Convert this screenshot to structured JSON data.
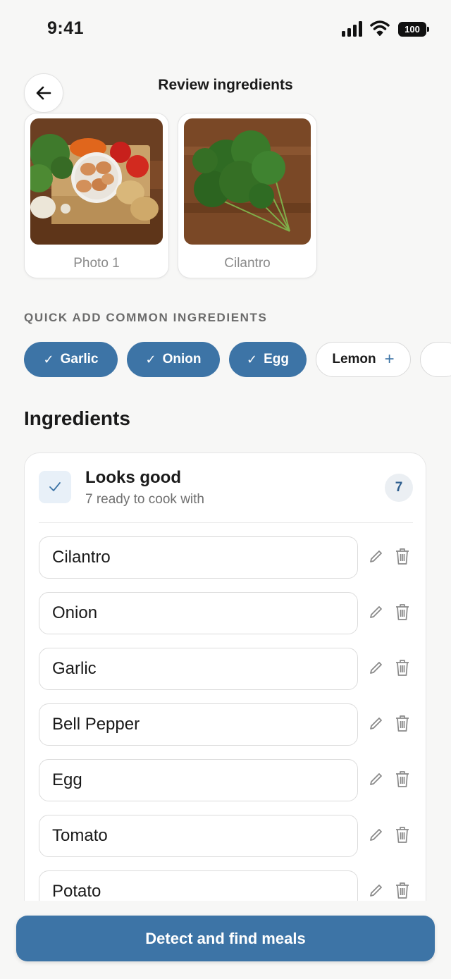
{
  "status_bar": {
    "time": "9:41",
    "battery": "100"
  },
  "header": {
    "title": "Review ingredients"
  },
  "photos": [
    {
      "caption": "Photo 1"
    },
    {
      "caption": "Cilantro"
    }
  ],
  "quick_add": {
    "label": "QUICK ADD COMMON INGREDIENTS",
    "chips": [
      {
        "label": "Garlic",
        "selected": true
      },
      {
        "label": "Onion",
        "selected": true
      },
      {
        "label": "Egg",
        "selected": true
      },
      {
        "label": "Lemon",
        "selected": false
      }
    ]
  },
  "ingredients": {
    "heading": "Ingredients",
    "status_title": "Looks good",
    "status_subtitle": "7 ready to cook with",
    "count": "7",
    "items": [
      "Cilantro",
      "Onion",
      "Garlic",
      "Bell Pepper",
      "Egg",
      "Tomato",
      "Potato"
    ]
  },
  "cta": {
    "label": "Detect and find meals"
  },
  "colors": {
    "accent": "#3d74a6",
    "background": "#f7f7f6",
    "badge_bg": "#ebeff3"
  }
}
